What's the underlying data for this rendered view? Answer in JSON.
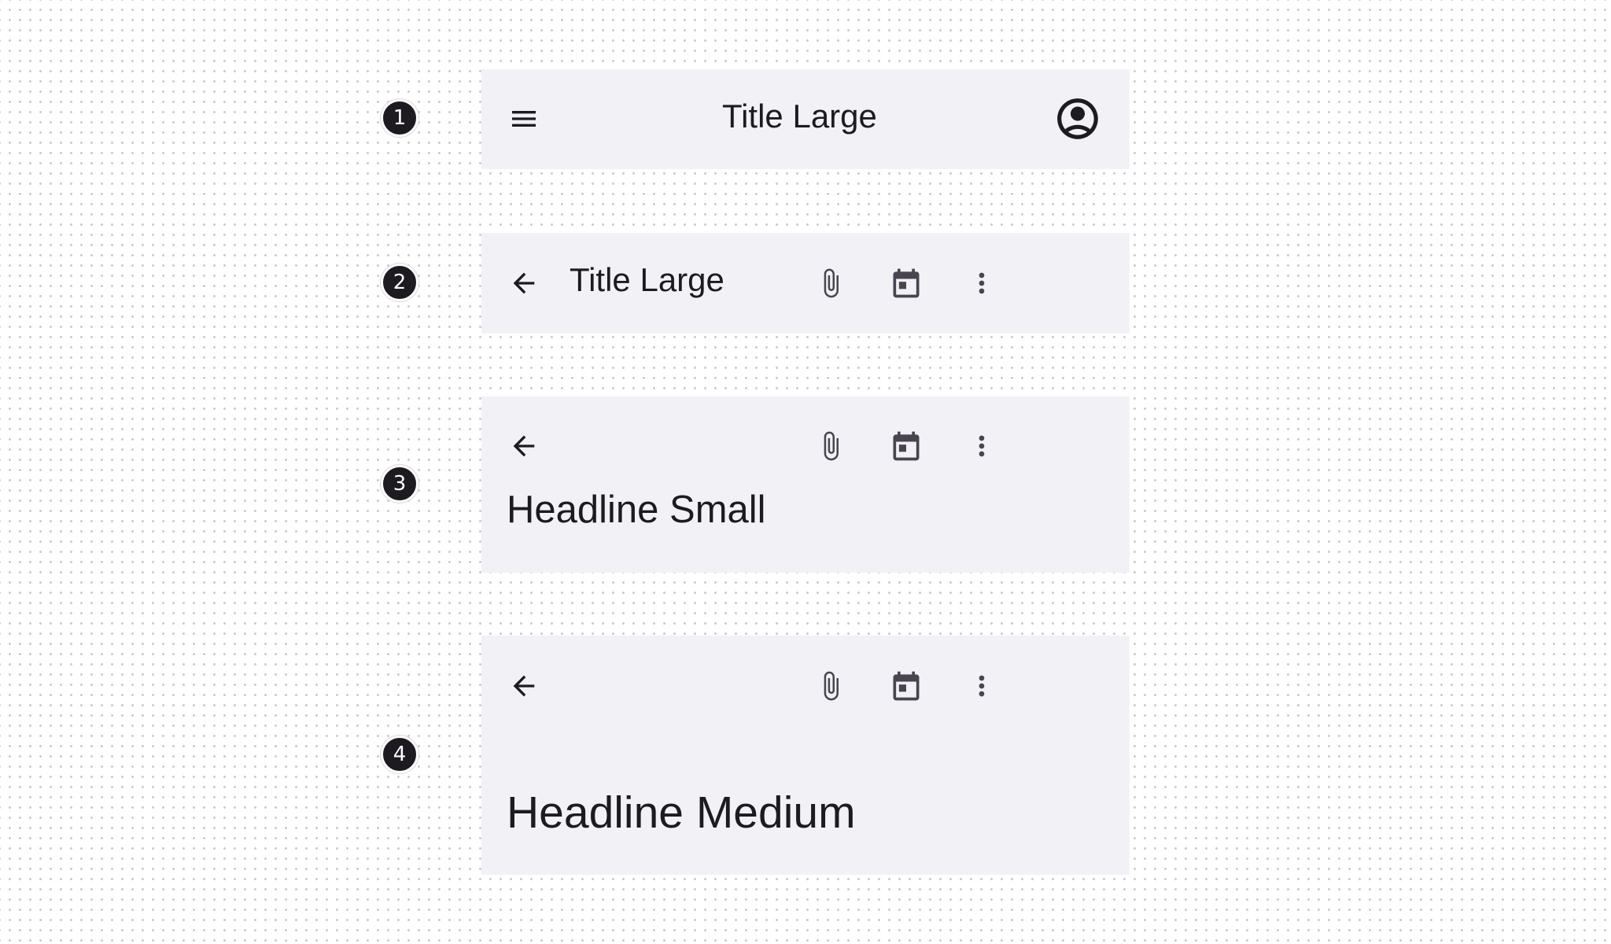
{
  "colors": {
    "surface": "#f2f2f6",
    "on_surface": "#1c1b1f",
    "icon_muted": "#49454f",
    "badge_fill": "#1d1b20",
    "background_dots": "#c9c9cc"
  },
  "badges": [
    "1",
    "2",
    "3",
    "4"
  ],
  "bars": [
    {
      "variant": "center-aligned",
      "title": "Title Large",
      "leading_icon": "menu-icon",
      "trailing_icons": [
        "account-circle-icon"
      ]
    },
    {
      "variant": "small",
      "title": "Title Large",
      "leading_icon": "arrow-back-icon",
      "trailing_icons": [
        "attach-file-icon",
        "calendar-icon",
        "more-vert-icon"
      ]
    },
    {
      "variant": "medium",
      "title": "Headline Small",
      "leading_icon": "arrow-back-icon",
      "trailing_icons": [
        "attach-file-icon",
        "calendar-icon",
        "more-vert-icon"
      ]
    },
    {
      "variant": "large",
      "title": "Headline Medium",
      "leading_icon": "arrow-back-icon",
      "trailing_icons": [
        "attach-file-icon",
        "calendar-icon",
        "more-vert-icon"
      ]
    }
  ]
}
